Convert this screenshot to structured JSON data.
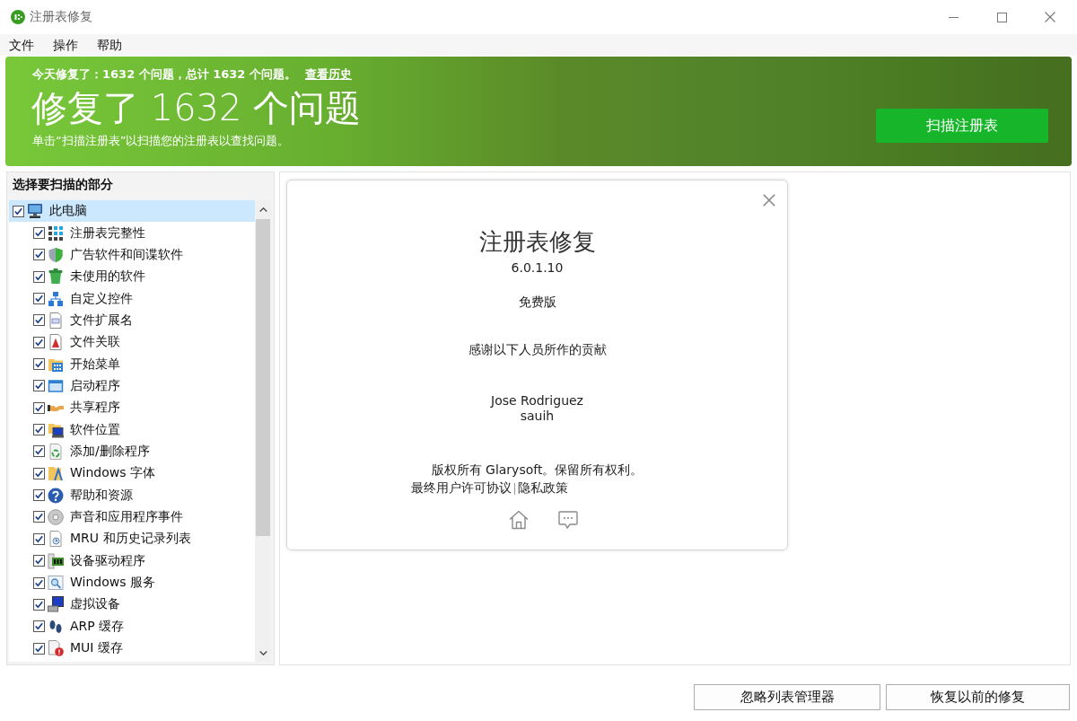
{
  "window": {
    "title": "注册表修复"
  },
  "menu": [
    "文件",
    "操作",
    "帮助"
  ],
  "banner": {
    "summary": "今天修复了：1632 个问题，总计 1632 个问题。",
    "history_link": "查看历史",
    "headline": "修复了 1632 个问题",
    "hint": "单击“扫描注册表”以扫描您的注册表以查找问题。",
    "scan_button": "扫描注册表"
  },
  "sections": {
    "title": "选择要扫描的部分",
    "tree": [
      {
        "label": "此电脑",
        "checked": true,
        "selected": true,
        "children": [
          {
            "label": "注册表完整性",
            "checked": true,
            "selected": false
          },
          {
            "label": "广告软件和间谍软件",
            "checked": true,
            "selected": false
          },
          {
            "label": "未使用的软件",
            "checked": true,
            "selected": false
          },
          {
            "label": "自定义控件",
            "checked": true,
            "selected": false
          },
          {
            "label": "文件扩展名",
            "checked": true,
            "selected": false
          },
          {
            "label": "文件关联",
            "checked": true,
            "selected": false
          },
          {
            "label": "开始菜单",
            "checked": true,
            "selected": false
          },
          {
            "label": "启动程序",
            "checked": true,
            "selected": false
          },
          {
            "label": "共享程序",
            "checked": true,
            "selected": false
          },
          {
            "label": "软件位置",
            "checked": true,
            "selected": false
          },
          {
            "label": "添加/删除程序",
            "checked": true,
            "selected": false
          },
          {
            "label": "Windows 字体",
            "checked": true,
            "selected": false
          },
          {
            "label": "帮助和资源",
            "checked": true,
            "selected": false
          },
          {
            "label": "声音和应用程序事件",
            "checked": true,
            "selected": false
          },
          {
            "label": "MRU 和历史记录列表",
            "checked": true,
            "selected": false
          },
          {
            "label": "设备驱动程序",
            "checked": true,
            "selected": false
          },
          {
            "label": "Windows 服务",
            "checked": true,
            "selected": false
          },
          {
            "label": "虚拟设备",
            "checked": true,
            "selected": false
          },
          {
            "label": "ARP 缓存",
            "checked": true,
            "selected": false
          },
          {
            "label": "MUI 缓存",
            "checked": true,
            "selected": false
          }
        ]
      }
    ]
  },
  "about_dialog": {
    "title": "注册表修复",
    "version": "6.0.1.10",
    "edition": "免费版",
    "thanks": "感谢以下人员所作的贡献",
    "contributors": [
      "Jose Rodriguez",
      "sauih"
    ],
    "copyright": "版权所有 Glarysoft。保留所有权利。",
    "links": [
      "最终用户许可协议",
      "隐私政策"
    ]
  },
  "buttons": [
    "忽略列表管理器",
    "恢复以前的修复"
  ]
}
